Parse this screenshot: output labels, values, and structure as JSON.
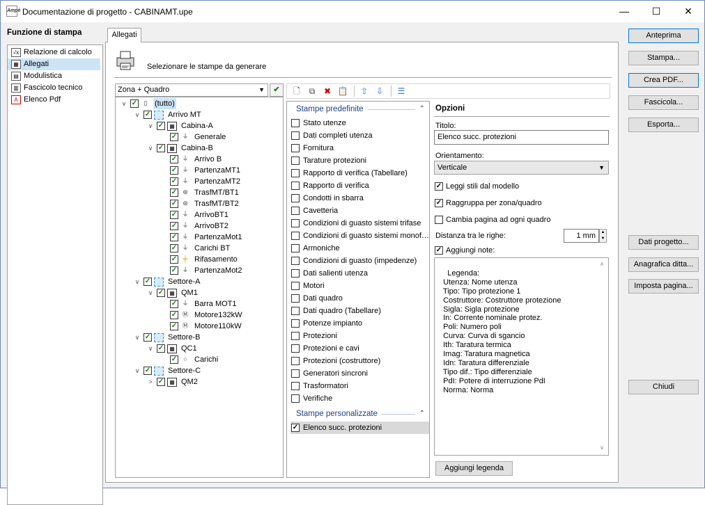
{
  "window": {
    "title": "Documentazione di progetto - CABINAMT.upe",
    "icon_text": "Ampè",
    "minimize": "—",
    "maximize": "☐",
    "close": "✕"
  },
  "left": {
    "title": "Funzione di stampa",
    "items": [
      {
        "label": "Relazione di calcolo",
        "icon": "calc-report-icon",
        "glyph": "√x"
      },
      {
        "label": "Allegati",
        "icon": "table-grid-icon",
        "glyph": "▦"
      },
      {
        "label": "Modulistica",
        "icon": "form-doc-icon",
        "glyph": "▤"
      },
      {
        "label": "Fascicolo tecnico",
        "icon": "binder-icon",
        "glyph": "▥"
      },
      {
        "label": "Elenco Pdf",
        "icon": "pdf-icon",
        "glyph": "A"
      }
    ]
  },
  "tab": {
    "label": "Allegati"
  },
  "main": {
    "instruction": "Selezionare le stampe da generare"
  },
  "combo": {
    "value": "Zona + Quadro",
    "action_glyph": "✔"
  },
  "tree": [
    {
      "label": "(tutto)",
      "level": 0,
      "toggle": "∨",
      "icon": "folder-all-icon",
      "selected": true
    },
    {
      "label": "Arrivo MT",
      "level": 1,
      "toggle": "∨",
      "icon": "zone-icon"
    },
    {
      "label": "Cabina-A",
      "level": 2,
      "toggle": "∨",
      "icon": "panel-icon"
    },
    {
      "label": "Generale",
      "level": 3,
      "toggle": "",
      "icon": "line-icon"
    },
    {
      "label": "Cabina-B",
      "level": 2,
      "toggle": "∨",
      "icon": "panel-icon"
    },
    {
      "label": "Arrivo B",
      "level": 3,
      "toggle": "",
      "icon": "line-icon"
    },
    {
      "label": "PartenzaMT1",
      "level": 3,
      "toggle": "",
      "icon": "line-icon"
    },
    {
      "label": "PartenzaMT2",
      "level": 3,
      "toggle": "",
      "icon": "line-icon"
    },
    {
      "label": "TrasfMT/BT1",
      "level": 3,
      "toggle": "",
      "icon": "transformer-icon"
    },
    {
      "label": "TrasfMT/BT2",
      "level": 3,
      "toggle": "",
      "icon": "transformer-icon"
    },
    {
      "label": "ArrivoBT1",
      "level": 3,
      "toggle": "",
      "icon": "line-icon"
    },
    {
      "label": "ArrivoBT2",
      "level": 3,
      "toggle": "",
      "icon": "line-icon"
    },
    {
      "label": "PartenzaMot1",
      "level": 3,
      "toggle": "",
      "icon": "line-icon"
    },
    {
      "label": "Carichi BT",
      "level": 3,
      "toggle": "",
      "icon": "line-icon"
    },
    {
      "label": "Rifasamento",
      "level": 3,
      "toggle": "",
      "icon": "capacitor-icon"
    },
    {
      "label": "PartenzaMot2",
      "level": 3,
      "toggle": "",
      "icon": "line-icon"
    },
    {
      "label": "Settore-A",
      "level": 1,
      "toggle": "∨",
      "icon": "zone-icon"
    },
    {
      "label": "QM1",
      "level": 2,
      "toggle": "∨",
      "icon": "panel-icon"
    },
    {
      "label": "Barra MOT1",
      "level": 3,
      "toggle": "",
      "icon": "line-icon"
    },
    {
      "label": "Motore132kW",
      "level": 3,
      "toggle": "",
      "icon": "motor-icon"
    },
    {
      "label": "Motore110kW",
      "level": 3,
      "toggle": "",
      "icon": "motor-icon"
    },
    {
      "label": "Settore-B",
      "level": 1,
      "toggle": "∨",
      "icon": "zone-icon"
    },
    {
      "label": "QC1",
      "level": 2,
      "toggle": "∨",
      "icon": "panel-icon"
    },
    {
      "label": "Carichi",
      "level": 3,
      "toggle": "",
      "icon": "load-icon"
    },
    {
      "label": "Settore-C",
      "level": 1,
      "toggle": "∨",
      "icon": "zone-icon"
    },
    {
      "label": "QM2",
      "level": 2,
      "toggle": ">",
      "icon": "panel-icon"
    }
  ],
  "toolbar": [
    {
      "name": "new-page-icon",
      "glyph": "🗋"
    },
    {
      "name": "copy-page-icon",
      "glyph": "⧉"
    },
    {
      "name": "delete-page-icon",
      "glyph": "✖"
    },
    {
      "name": "paste-page-icon",
      "glyph": "📋"
    },
    {
      "name": "move-up-icon",
      "glyph": "⇧"
    },
    {
      "name": "move-down-icon",
      "glyph": "⇩"
    },
    {
      "name": "list-menu-icon",
      "glyph": "☰"
    }
  ],
  "predefined": {
    "header": "Stampe predefinite",
    "chevron": "⌃",
    "items": [
      "Stato utenze",
      "Dati completi utenza",
      "Fornitura",
      "Tarature protezioni",
      "Rapporto di verifica (Tabellare)",
      "Rapporto di verifica",
      "Condotti in sbarra",
      "Cavetteria",
      "Condizioni di guasto sistemi trifase",
      "Condizioni di guasto sistemi monof…",
      "Armoniche",
      "Condizioni di guasto (impedenze)",
      "Dati salienti utenza",
      "Motori",
      "Dati quadro",
      "Dati quadro (Tabellare)",
      "Potenze impianto",
      "Protezioni",
      "Protezioni e cavi",
      "Protezioni (costruttore)",
      "Generatori sincroni",
      "Trasformatori",
      "Verifiche"
    ]
  },
  "custom": {
    "header": "Stampe personalizzate",
    "chevron": "⌃",
    "items": [
      {
        "label": "Elenco succ. protezioni",
        "checked": true
      }
    ]
  },
  "options": {
    "title": "Opzioni",
    "title_label": "Titolo:",
    "title_value": "Elenco succ. protezioni",
    "orientation_label": "Orientamento:",
    "orientation_value": "Verticale",
    "check_models": "Leggi stili dal modello",
    "check_group": "Raggruppa per zona/quadro",
    "check_pagebreak": "Cambia pagina ad ogni quadro",
    "distance_label": "Distanza tra le righe:",
    "distance_value": "1 mm",
    "notes_label": "Aggiungi note:",
    "notes_text": "Legenda:\n  Utenza: Nome utenza\n  Tipo: Tipo protezione 1\n  Costruttore: Costruttore protezione\n  Sigla: Sigla protezione\n  In: Corrente nominale protez.\n  Poli: Numero poli\n  Curva: Curva di sgancio\n  Ith: Taratura termica\n  Imag: Taratura magnetica\n  Idn: Taratura differenziale\n  Tipo dif.: Tipo differenziale\n  PdI: Potere di interruzione PdI\n  Norma: Norma",
    "add_legend": "Aggiungi legenda"
  },
  "buttons": {
    "preview": "Anteprima",
    "print": "Stampa...",
    "create_pdf": "Crea PDF...",
    "bundle": "Fascicola...",
    "export": "Esporta...",
    "project_data": "Dati progetto...",
    "company": "Anagrafica ditta...",
    "page_setup": "Imposta pagina...",
    "close": "Chiudi"
  },
  "colors": {
    "accent": "#0078d7",
    "selection": "#cde4f7",
    "group_header": "#1e3f8a",
    "check_green": "#1a7a1a"
  }
}
